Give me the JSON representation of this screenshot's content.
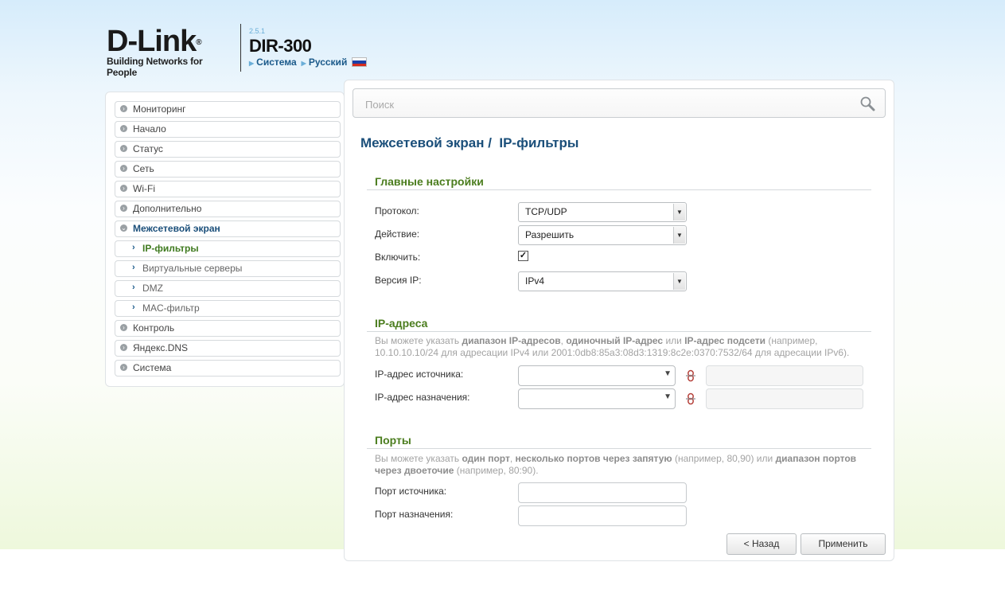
{
  "header": {
    "logo_text": "D-Link",
    "logo_tagline": "Building Networks for People",
    "firmware_version": "2.5.1",
    "model": "DIR-300",
    "system_link": "Система",
    "language_link": "Русский",
    "flag_colors": [
      "#ffffff",
      "#1a3fa8",
      "#d52b1e"
    ]
  },
  "sidebar": {
    "items": [
      {
        "label": "Мониторинг",
        "type": "top"
      },
      {
        "label": "Начало",
        "type": "top"
      },
      {
        "label": "Статус",
        "type": "top"
      },
      {
        "label": "Сеть",
        "type": "top"
      },
      {
        "label": "Wi-Fi",
        "type": "top"
      },
      {
        "label": "Дополнительно",
        "type": "top"
      },
      {
        "label": "Межсетевой экран",
        "type": "top",
        "expanded": true
      },
      {
        "label": "IP-фильтры",
        "type": "sub",
        "active": true
      },
      {
        "label": "Виртуальные серверы",
        "type": "sub"
      },
      {
        "label": "DMZ",
        "type": "sub"
      },
      {
        "label": "MAC-фильтр",
        "type": "sub"
      },
      {
        "label": "Контроль",
        "type": "top"
      },
      {
        "label": "Яндекс.DNS",
        "type": "top"
      },
      {
        "label": "Система",
        "type": "top"
      }
    ]
  },
  "search": {
    "placeholder": "Поиск",
    "icon": "magnifier-icon"
  },
  "page": {
    "title_part1": "Межсетевой экран /",
    "title_part2": "IP-фильтры"
  },
  "main_settings": {
    "title": "Главные настройки",
    "protocol_label": "Протокол:",
    "protocol_value": "TCP/UDP",
    "action_label": "Действие:",
    "action_value": "Разрешить",
    "enable_label": "Включить:",
    "enable_checked": true,
    "ip_version_label": "Версия IP:",
    "ip_version_value": "IPv4"
  },
  "ip_addresses": {
    "title": "IP-адреса",
    "hint_1": "Вы можете указать",
    "hint_b1": "диапазон IP-адресов",
    "hint_2": ",",
    "hint_b2": "одиночный IP-адрес",
    "hint_3": "или",
    "hint_b3": "IP-адрес подсети",
    "hint_4": "(например, 10.10.10.10/24 для адресации IPv4 или 2001:0db8:85a3:08d3:1319:8c2e:0370:7532/64 для адресации IPv6).",
    "source_label": "IP-адрес источника:",
    "dest_label": "IP-адрес назначения:"
  },
  "ports": {
    "title": "Порты",
    "hint_1": "Вы можете указать",
    "hint_b1": "один порт",
    "hint_2": ",",
    "hint_b2": "несколько портов через запятую",
    "hint_3": "(например, 80,90) или",
    "hint_b3": "диапазон портов через двоеточие",
    "hint_4": "(например, 80:90).",
    "source_label": "Порт источника:",
    "dest_label": "Порт назначения:"
  },
  "buttons": {
    "back": "< Назад",
    "apply": "Применить"
  }
}
